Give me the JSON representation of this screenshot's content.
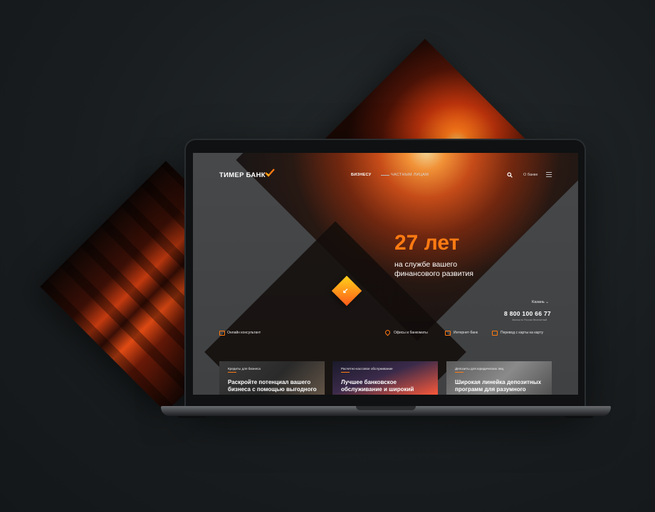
{
  "brand": {
    "name": "ТИМЕР БАНК",
    "accent": "#ff7a12"
  },
  "nav": {
    "business": "БИЗНЕСУ",
    "private": "ЧАСТНЫМ ЛИЦАМ",
    "about": "О банке"
  },
  "hero": {
    "years": "27 лет",
    "subtitle_line1": "на службе вашего",
    "subtitle_line2": "финансового развития"
  },
  "contact": {
    "city": "Казань ⌄",
    "phone": "8 800 100 66 77",
    "phone_note": "Звонок по России бесплатный"
  },
  "utilities": {
    "consultant": "Онлайн консультант",
    "offices": "Офисы и банкоматы",
    "internet_bank": "Интернет-банк",
    "transfer": "Перевод с карты на карту"
  },
  "cards": [
    {
      "tag": "Кредиты для бизнеса",
      "title": "Раскройте потенциал вашего бизнеса с помощью выгодного"
    },
    {
      "tag": "Расчетно-кассовое обслуживание",
      "title": "Лучшее банковское обслуживание и широкий"
    },
    {
      "tag": "Депозиты для юридических лиц",
      "title": "Широкая линейка депозитных программ для разумного"
    }
  ]
}
